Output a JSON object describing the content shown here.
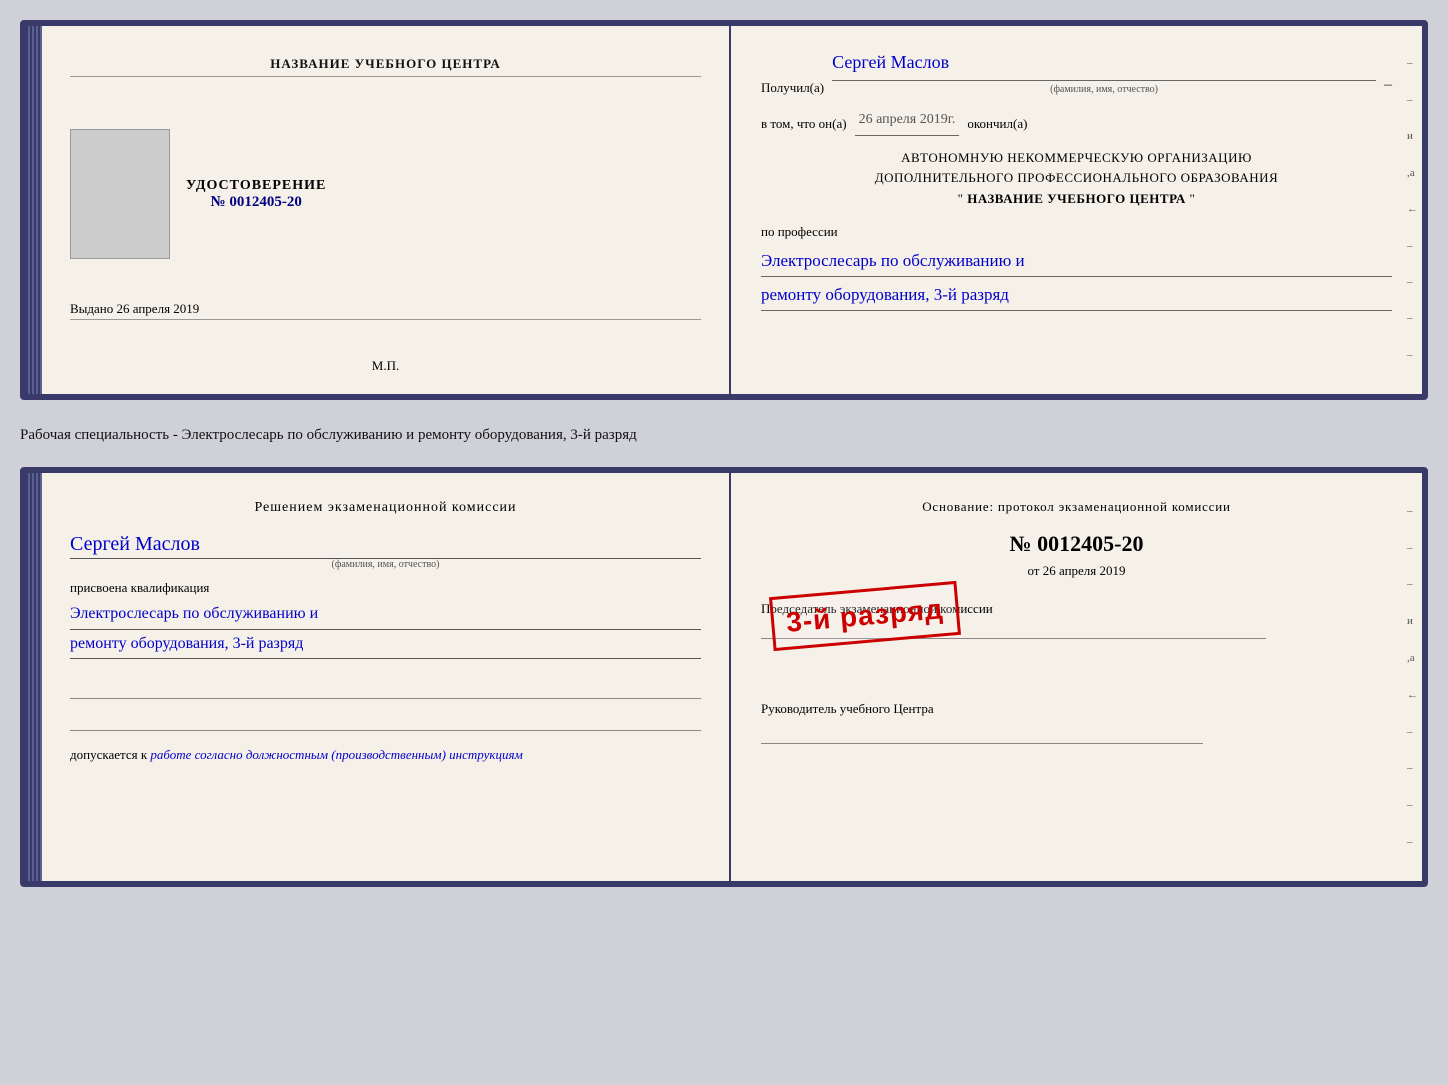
{
  "top_doc": {
    "left": {
      "center_name_label": "НАЗВАНИЕ УЧЕБНОГО ЦЕНТРА",
      "udostoverenie": "УДОСТОВЕРЕНИЕ",
      "number_prefix": "№",
      "number": "0012405-20",
      "vydano_label": "Выдано",
      "vydano_date": "26 апреля 2019",
      "mp_label": "М.П."
    },
    "right": {
      "poluchil_label": "Получил(а)",
      "name_handwritten": "Сергей Маслов",
      "fio_subtitle": "(фамилия, имя, отчество)",
      "vtom_label": "в том, что он(а)",
      "date_handwritten": "26 апреля 2019г.",
      "okonchil_label": "окончил(а)",
      "org_line1": "АВТОНОМНУЮ НЕКОММЕРЧЕСКУЮ ОРГАНИЗАЦИЮ",
      "org_line2": "ДОПОЛНИТЕЛЬНОГО ПРОФЕССИОНАЛЬНОГО ОБРАЗОВАНИЯ",
      "org_quote_open": "\"",
      "org_center_name": "НАЗВАНИЕ УЧЕБНОГО ЦЕНТРА",
      "org_quote_close": "\"",
      "po_professii_label": "по профессии",
      "profession_line1": "Электрослесарь по обслуживанию и",
      "profession_line2": "ремонту оборудования, 3-й разряд"
    }
  },
  "between_text": "Рабочая специальность - Электрослесарь по обслуживанию и ремонту оборудования, 3-й разряд",
  "bottom_doc": {
    "left": {
      "resheniem_line1": "Решением  экзаменационной  комиссии",
      "person_name": "Сергей Маслов",
      "fio_subtitle": "(фамилия, имя, отчество)",
      "prisvoena_label": "присвоена квалификация",
      "qual_line1": "Электрослесарь по обслуживанию и",
      "qual_line2": "ремонту оборудования, 3-й разряд",
      "dopuskaetsya_label": "допускается к",
      "dopuskaetsya_text": "работе согласно должностным (производственным) инструкциям"
    },
    "right": {
      "osnovanie_label": "Основание: протокол экзаменационной  комиссии",
      "number_prefix": "№",
      "number": "0012405-20",
      "ot_prefix": "от",
      "ot_date": "26 апреля 2019",
      "predsedatel_label": "Председатель экзаменационной комиссии",
      "stamp_text": "3-й разряд",
      "rukovoditel_label": "Руководитель учебного Центра"
    }
  }
}
